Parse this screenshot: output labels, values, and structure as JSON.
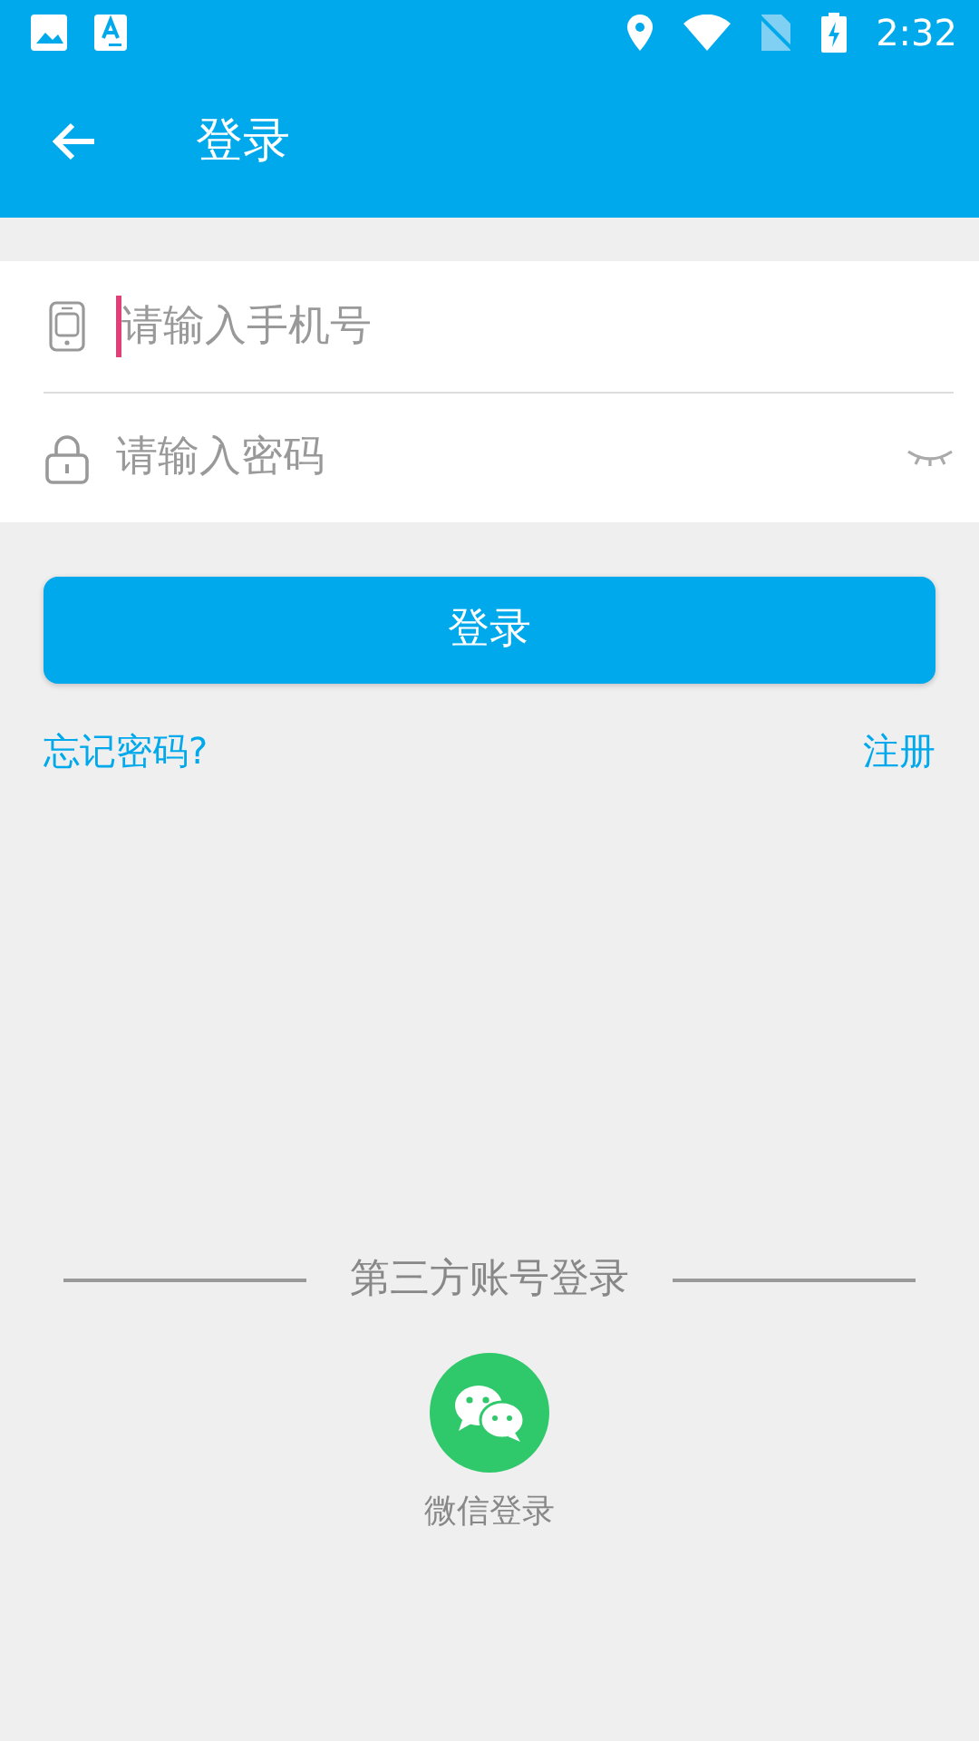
{
  "status_bar": {
    "time": "2:32"
  },
  "app_bar": {
    "title": "登录"
  },
  "fields": [
    {
      "kind": "phone",
      "placeholder": "请输入手机号",
      "focused": true
    },
    {
      "kind": "password",
      "placeholder": "请输入密码",
      "focused": false
    }
  ],
  "login_button": "登录",
  "links": {
    "forgot": "忘记密码?",
    "register": "注册"
  },
  "third_party": {
    "heading": "第三方账号登录",
    "items": [
      {
        "label": "微信登录"
      }
    ]
  }
}
